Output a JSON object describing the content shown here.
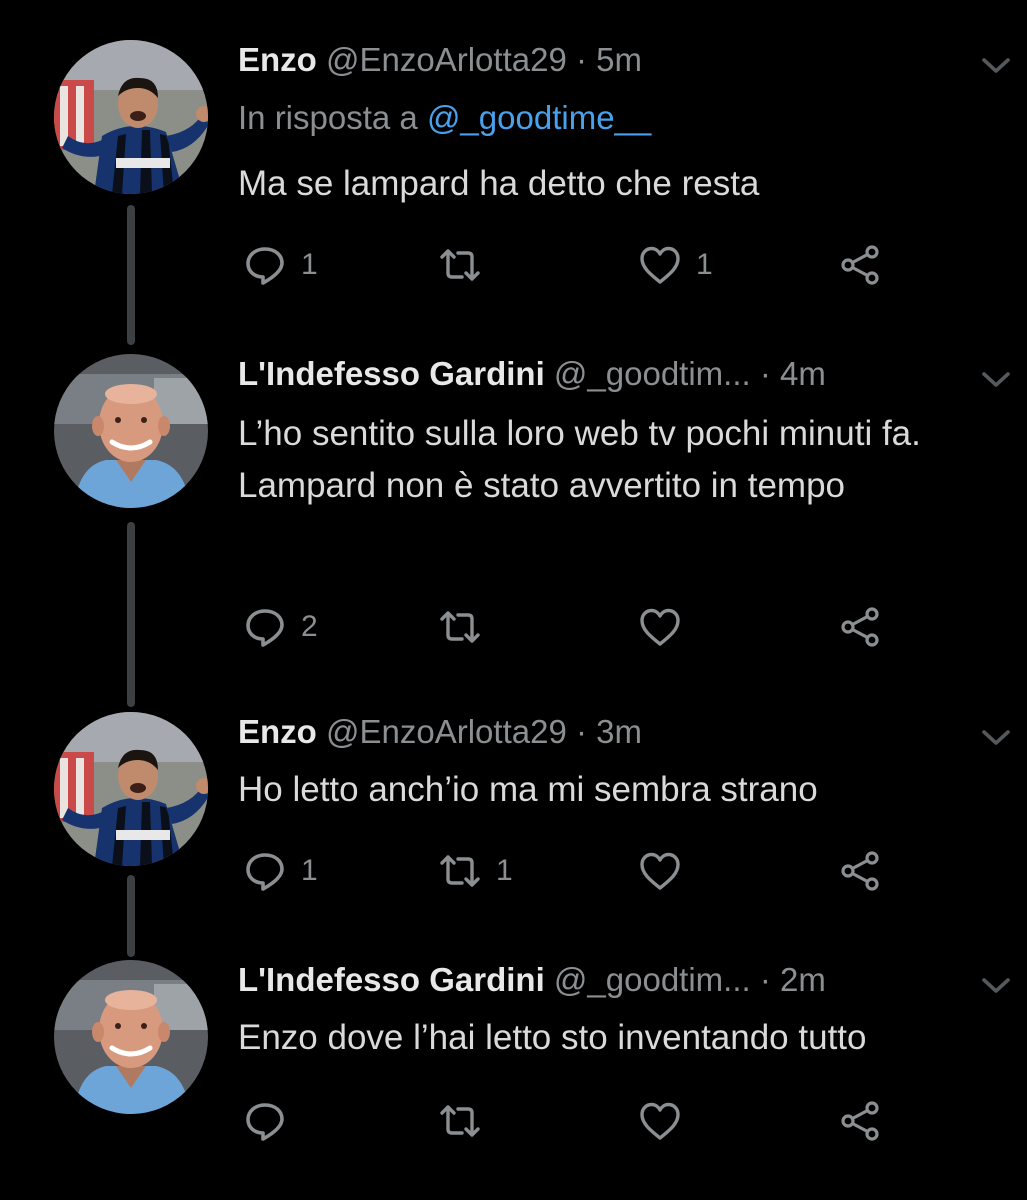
{
  "colors": {
    "background": "#000000",
    "muted": "#8b8f92",
    "mention": "#4aa1eb",
    "text": "#dadada"
  },
  "tweets": [
    {
      "name": "Enzo",
      "handle": "@EnzoArlotta29",
      "sep": "·",
      "time": "5m",
      "reply_prefix": "In risposta a ",
      "reply_handle": "@_goodtime__",
      "text": "Ma se lampard ha detto che resta",
      "replies": "1",
      "retweets": "",
      "likes": "1",
      "avatar_icon": "player-avatar"
    },
    {
      "name": "L'Indefesso Gardini",
      "handle": "@_goodtim...",
      "sep": "·",
      "time": "4m",
      "text": "L’ho sentito sulla loro web tv pochi minuti fa. Lampard non è stato avvertito in tempo",
      "replies": "2",
      "retweets": "",
      "likes": "",
      "avatar_icon": "man-avatar"
    },
    {
      "name": "Enzo",
      "handle": "@EnzoArlotta29",
      "sep": "·",
      "time": "3m",
      "text": "Ho letto anch’io ma mi sembra strano",
      "replies": "1",
      "retweets": "1",
      "likes": "",
      "avatar_icon": "player-avatar"
    },
    {
      "name": "L'Indefesso Gardini",
      "handle": "@_goodtim...",
      "sep": "·",
      "time": "2m",
      "text": "Enzo dove l’hai letto sto inventando tutto",
      "replies": "",
      "retweets": "",
      "likes": "",
      "avatar_icon": "man-avatar"
    }
  ]
}
